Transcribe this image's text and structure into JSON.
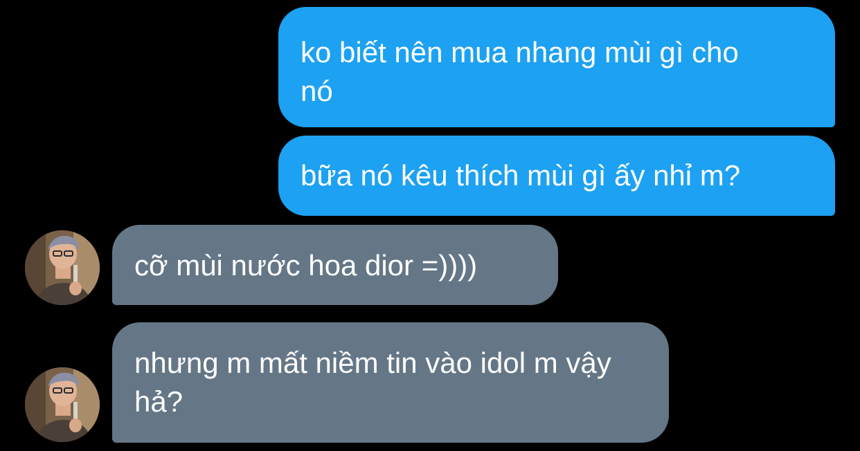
{
  "messages": [
    {
      "sender": "me",
      "text": "ko biết nên mua nhang mùi gì cho nó"
    },
    {
      "sender": "me",
      "text": "bữa nó kêu thích mùi gì ấy nhỉ m?"
    },
    {
      "sender": "friend",
      "text": "cỡ mùi nước hoa dior =))))"
    },
    {
      "sender": "friend",
      "text": "nhưng m mất niềm tin vào idol m vậy hả?"
    }
  ],
  "colors": {
    "background": "#000000",
    "sent_bubble": "#1da1f2",
    "received_bubble": "#657786",
    "text": "#ffffff"
  }
}
